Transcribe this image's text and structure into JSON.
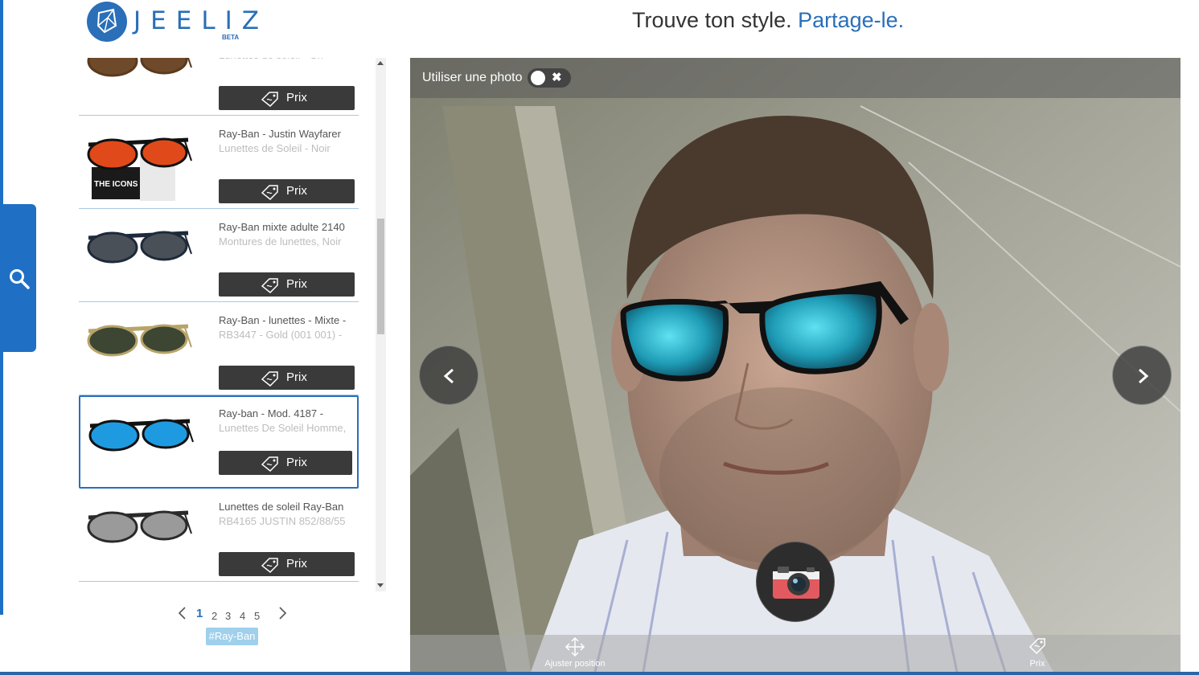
{
  "brand": {
    "name": "JEELIZ",
    "badge": "BETA"
  },
  "header": {
    "tagline_main": "Trouve ton style.",
    "tagline_accent": "Partage-le."
  },
  "search_tab": {
    "icon": "search-icon"
  },
  "products": [
    {
      "title": "",
      "subtitle": "Lunettes de soleil - Gri -",
      "price_label": "Prix",
      "lens": "#6e4a2a",
      "frame": "#5a3a1e"
    },
    {
      "title": "Ray-Ban - Justin Wayfarer",
      "subtitle": "Lunettes de Soleil - Noir",
      "price_label": "Prix",
      "lens": "#e04a1a",
      "frame": "#111111",
      "badge_text": "THE ICONS"
    },
    {
      "title": "Ray-Ban mixte adulte 2140",
      "subtitle": "Montures de lunettes, Noir",
      "price_label": "Prix",
      "lens": "#4a5058",
      "frame": "#1e2a3a"
    },
    {
      "title": "Ray-Ban - lunettes - Mixte -",
      "subtitle": "RB3447 - Gold (001 001) -",
      "price_label": "Prix",
      "lens": "#3c4632",
      "frame": "#b8a46a"
    },
    {
      "title": "Ray-ban - Mod. 4187 -",
      "subtitle": "Lunettes De Soleil Homme,",
      "price_label": "Prix",
      "lens": "#1e9be0",
      "frame": "#111111",
      "selected": true
    },
    {
      "title": "Lunettes de soleil Ray-Ban",
      "subtitle": "RB4165 JUSTIN 852/88/55",
      "price_label": "Prix",
      "lens": "#9a9a9a",
      "frame": "#2a2a2a"
    }
  ],
  "pagination": {
    "pages": [
      "1",
      "2",
      "3",
      "4",
      "5"
    ],
    "current": "1"
  },
  "filter_tag": "#Ray-Ban",
  "viewer": {
    "use_photo_label": "Utiliser une photo",
    "toggle_close": "✖",
    "adjust_label": "Ajuster position",
    "price_label": "Prix"
  },
  "colors": {
    "brand_blue": "#2a6fb8",
    "sidebar_blue": "#1f6fc5",
    "dark_button": "#3a3a3a"
  }
}
